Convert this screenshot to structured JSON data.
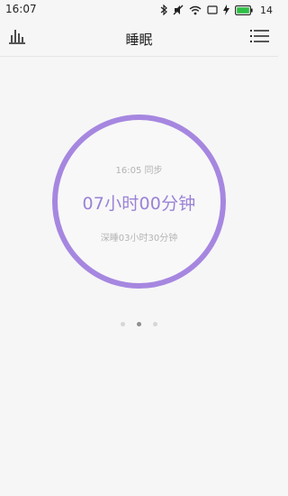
{
  "status_bar": {
    "time": "16:07",
    "battery_level": "14",
    "icons": [
      "bluetooth-icon",
      "mute-icon",
      "wifi-icon",
      "screen-icon",
      "charging-icon",
      "battery-icon"
    ]
  },
  "app_bar": {
    "title": "睡眠",
    "left_icon": "bar-chart-icon",
    "right_icon": "menu-list-icon"
  },
  "sleep_ring": {
    "sync_text": "16:05 同步",
    "duration": "07小时00分钟",
    "deep_sleep": "深睡03小时30分钟",
    "ring_color": "#a687e0",
    "text_color": "#9a82d6"
  },
  "pager": {
    "count": 3,
    "active_index": 1
  }
}
